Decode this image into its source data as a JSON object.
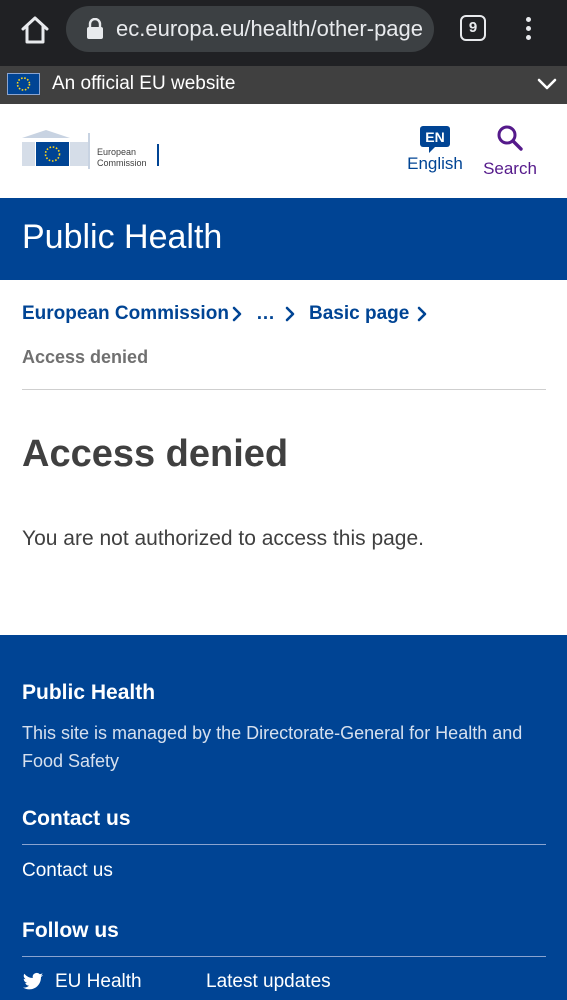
{
  "browser": {
    "url": "ec.europa.eu/health/other-page",
    "tab_count": "9",
    "icons": [
      "home-icon",
      "lock-icon",
      "tabs-icon",
      "menu-icon"
    ]
  },
  "official_bar": {
    "text": "An official EU website",
    "icons": [
      "eu-flag-icon",
      "chevron-down-icon"
    ]
  },
  "header": {
    "logo_line1": "European",
    "logo_line2": "Commission",
    "lang_code": "EN",
    "lang_label": "English",
    "search_label": "Search"
  },
  "banner": {
    "title": "Public Health"
  },
  "breadcrumb": {
    "items": [
      "European Commission",
      "…",
      "Basic page"
    ],
    "current": "Access denied"
  },
  "content": {
    "title": "Access denied",
    "message": "You are not authorized to access this page."
  },
  "footer": {
    "site_title": "Public Health",
    "description": "This site is managed by the Directorate-General for Health and Food Safety",
    "contact_heading": "Contact us",
    "contact_link": "Contact us",
    "follow_heading": "Follow us",
    "social_links": [
      "EU Health",
      "Latest updates"
    ]
  },
  "colors": {
    "brand_blue": "#004494",
    "search_purple": "#551a8b",
    "chrome_dark": "#202124",
    "official_bar": "#404040"
  }
}
